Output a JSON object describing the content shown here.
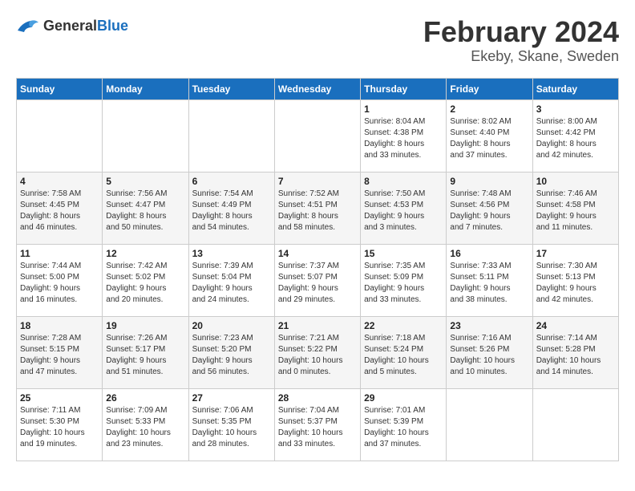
{
  "header": {
    "logo_general": "General",
    "logo_blue": "Blue",
    "title": "February 2024",
    "subtitle": "Ekeby, Skane, Sweden"
  },
  "weekdays": [
    "Sunday",
    "Monday",
    "Tuesday",
    "Wednesday",
    "Thursday",
    "Friday",
    "Saturday"
  ],
  "weeks": [
    [
      {
        "day": "",
        "info": ""
      },
      {
        "day": "",
        "info": ""
      },
      {
        "day": "",
        "info": ""
      },
      {
        "day": "",
        "info": ""
      },
      {
        "day": "1",
        "info": "Sunrise: 8:04 AM\nSunset: 4:38 PM\nDaylight: 8 hours\nand 33 minutes."
      },
      {
        "day": "2",
        "info": "Sunrise: 8:02 AM\nSunset: 4:40 PM\nDaylight: 8 hours\nand 37 minutes."
      },
      {
        "day": "3",
        "info": "Sunrise: 8:00 AM\nSunset: 4:42 PM\nDaylight: 8 hours\nand 42 minutes."
      }
    ],
    [
      {
        "day": "4",
        "info": "Sunrise: 7:58 AM\nSunset: 4:45 PM\nDaylight: 8 hours\nand 46 minutes."
      },
      {
        "day": "5",
        "info": "Sunrise: 7:56 AM\nSunset: 4:47 PM\nDaylight: 8 hours\nand 50 minutes."
      },
      {
        "day": "6",
        "info": "Sunrise: 7:54 AM\nSunset: 4:49 PM\nDaylight: 8 hours\nand 54 minutes."
      },
      {
        "day": "7",
        "info": "Sunrise: 7:52 AM\nSunset: 4:51 PM\nDaylight: 8 hours\nand 58 minutes."
      },
      {
        "day": "8",
        "info": "Sunrise: 7:50 AM\nSunset: 4:53 PM\nDaylight: 9 hours\nand 3 minutes."
      },
      {
        "day": "9",
        "info": "Sunrise: 7:48 AM\nSunset: 4:56 PM\nDaylight: 9 hours\nand 7 minutes."
      },
      {
        "day": "10",
        "info": "Sunrise: 7:46 AM\nSunset: 4:58 PM\nDaylight: 9 hours\nand 11 minutes."
      }
    ],
    [
      {
        "day": "11",
        "info": "Sunrise: 7:44 AM\nSunset: 5:00 PM\nDaylight: 9 hours\nand 16 minutes."
      },
      {
        "day": "12",
        "info": "Sunrise: 7:42 AM\nSunset: 5:02 PM\nDaylight: 9 hours\nand 20 minutes."
      },
      {
        "day": "13",
        "info": "Sunrise: 7:39 AM\nSunset: 5:04 PM\nDaylight: 9 hours\nand 24 minutes."
      },
      {
        "day": "14",
        "info": "Sunrise: 7:37 AM\nSunset: 5:07 PM\nDaylight: 9 hours\nand 29 minutes."
      },
      {
        "day": "15",
        "info": "Sunrise: 7:35 AM\nSunset: 5:09 PM\nDaylight: 9 hours\nand 33 minutes."
      },
      {
        "day": "16",
        "info": "Sunrise: 7:33 AM\nSunset: 5:11 PM\nDaylight: 9 hours\nand 38 minutes."
      },
      {
        "day": "17",
        "info": "Sunrise: 7:30 AM\nSunset: 5:13 PM\nDaylight: 9 hours\nand 42 minutes."
      }
    ],
    [
      {
        "day": "18",
        "info": "Sunrise: 7:28 AM\nSunset: 5:15 PM\nDaylight: 9 hours\nand 47 minutes."
      },
      {
        "day": "19",
        "info": "Sunrise: 7:26 AM\nSunset: 5:17 PM\nDaylight: 9 hours\nand 51 minutes."
      },
      {
        "day": "20",
        "info": "Sunrise: 7:23 AM\nSunset: 5:20 PM\nDaylight: 9 hours\nand 56 minutes."
      },
      {
        "day": "21",
        "info": "Sunrise: 7:21 AM\nSunset: 5:22 PM\nDaylight: 10 hours\nand 0 minutes."
      },
      {
        "day": "22",
        "info": "Sunrise: 7:18 AM\nSunset: 5:24 PM\nDaylight: 10 hours\nand 5 minutes."
      },
      {
        "day": "23",
        "info": "Sunrise: 7:16 AM\nSunset: 5:26 PM\nDaylight: 10 hours\nand 10 minutes."
      },
      {
        "day": "24",
        "info": "Sunrise: 7:14 AM\nSunset: 5:28 PM\nDaylight: 10 hours\nand 14 minutes."
      }
    ],
    [
      {
        "day": "25",
        "info": "Sunrise: 7:11 AM\nSunset: 5:30 PM\nDaylight: 10 hours\nand 19 minutes."
      },
      {
        "day": "26",
        "info": "Sunrise: 7:09 AM\nSunset: 5:33 PM\nDaylight: 10 hours\nand 23 minutes."
      },
      {
        "day": "27",
        "info": "Sunrise: 7:06 AM\nSunset: 5:35 PM\nDaylight: 10 hours\nand 28 minutes."
      },
      {
        "day": "28",
        "info": "Sunrise: 7:04 AM\nSunset: 5:37 PM\nDaylight: 10 hours\nand 33 minutes."
      },
      {
        "day": "29",
        "info": "Sunrise: 7:01 AM\nSunset: 5:39 PM\nDaylight: 10 hours\nand 37 minutes."
      },
      {
        "day": "",
        "info": ""
      },
      {
        "day": "",
        "info": ""
      }
    ]
  ]
}
